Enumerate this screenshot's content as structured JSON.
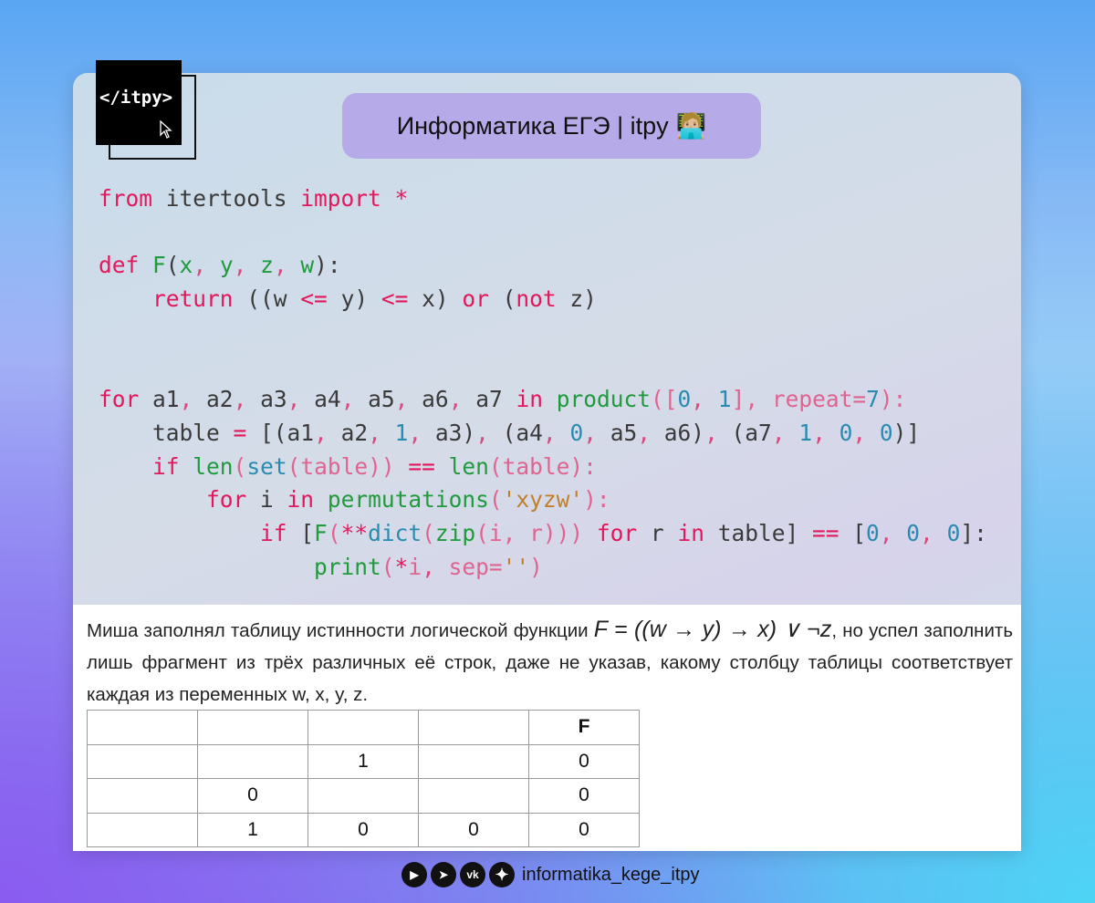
{
  "logo": {
    "text": "</itpy>"
  },
  "header": {
    "title": "Информатика ЕГЭ | itpy",
    "emoji": "🧑🏼‍💻"
  },
  "code": [
    [
      [
        "k",
        "from"
      ],
      [
        "d",
        " itertools "
      ],
      [
        "k",
        "import"
      ],
      [
        "k",
        " *"
      ]
    ],
    [],
    [
      [
        "k",
        "def"
      ],
      [
        "g",
        " F"
      ],
      [
        "d",
        "("
      ],
      [
        "g",
        "x"
      ],
      [
        "c",
        ","
      ],
      [
        "g",
        " y"
      ],
      [
        "c",
        ","
      ],
      [
        "g",
        " z"
      ],
      [
        "c",
        ","
      ],
      [
        "g",
        " w"
      ],
      [
        "d",
        "):"
      ]
    ],
    [
      [
        "d",
        "    "
      ],
      [
        "k",
        "return"
      ],
      [
        "d",
        " ((w "
      ],
      [
        "k",
        "<="
      ],
      [
        "d",
        " y) "
      ],
      [
        "k",
        "<="
      ],
      [
        "d",
        " x) "
      ],
      [
        "k",
        "or"
      ],
      [
        "d",
        " ("
      ],
      [
        "k",
        "not"
      ],
      [
        "d",
        " z)"
      ]
    ],
    [],
    [],
    [
      [
        "k",
        "for"
      ],
      [
        "d",
        " a1"
      ],
      [
        "c",
        ","
      ],
      [
        "d",
        " a2"
      ],
      [
        "c",
        ","
      ],
      [
        "d",
        " a3"
      ],
      [
        "c",
        ","
      ],
      [
        "d",
        " a4"
      ],
      [
        "c",
        ","
      ],
      [
        "d",
        " a5"
      ],
      [
        "c",
        ","
      ],
      [
        "d",
        " a6"
      ],
      [
        "c",
        ","
      ],
      [
        "d",
        " a7 "
      ],
      [
        "k",
        "in"
      ],
      [
        "g",
        " product"
      ],
      [
        "p",
        "(["
      ],
      [
        "n",
        "0"
      ],
      [
        "c",
        ","
      ],
      [
        "n",
        " 1"
      ],
      [
        "p",
        "], repeat="
      ],
      [
        "n",
        "7"
      ],
      [
        "p",
        "):"
      ]
    ],
    [
      [
        "d",
        "    table "
      ],
      [
        "k",
        "="
      ],
      [
        "d",
        " [(a1"
      ],
      [
        "c",
        ","
      ],
      [
        "d",
        " a2"
      ],
      [
        "c",
        ","
      ],
      [
        "n",
        " 1"
      ],
      [
        "c",
        ","
      ],
      [
        "d",
        " a3)"
      ],
      [
        "c",
        ","
      ],
      [
        "d",
        " (a4"
      ],
      [
        "c",
        ","
      ],
      [
        "n",
        " 0"
      ],
      [
        "c",
        ","
      ],
      [
        "d",
        " a5"
      ],
      [
        "c",
        ","
      ],
      [
        "d",
        " a6)"
      ],
      [
        "c",
        ","
      ],
      [
        "d",
        " (a7"
      ],
      [
        "c",
        ","
      ],
      [
        "n",
        " 1"
      ],
      [
        "c",
        ","
      ],
      [
        "n",
        " 0"
      ],
      [
        "c",
        ","
      ],
      [
        "n",
        " 0"
      ],
      [
        "d",
        ")]"
      ]
    ],
    [
      [
        "d",
        "    "
      ],
      [
        "k",
        "if"
      ],
      [
        "g",
        " len"
      ],
      [
        "p",
        "("
      ],
      [
        "n",
        "set"
      ],
      [
        "p",
        "(table))"
      ],
      [
        "k",
        " =="
      ],
      [
        "g",
        " len"
      ],
      [
        "p",
        "(table):"
      ]
    ],
    [
      [
        "d",
        "        "
      ],
      [
        "k",
        "for"
      ],
      [
        "d",
        " i "
      ],
      [
        "k",
        "in"
      ],
      [
        "g",
        " permutations"
      ],
      [
        "p",
        "("
      ],
      [
        "s",
        "'xyzw'"
      ],
      [
        "p",
        "):"
      ]
    ],
    [
      [
        "d",
        "            "
      ],
      [
        "k",
        "if"
      ],
      [
        "d",
        " ["
      ],
      [
        "g",
        "F"
      ],
      [
        "p",
        "("
      ],
      [
        "k",
        "**"
      ],
      [
        "n",
        "dict"
      ],
      [
        "p",
        "("
      ],
      [
        "g",
        "zip"
      ],
      [
        "p",
        "(i, r))) "
      ],
      [
        "k",
        "for"
      ],
      [
        "d",
        " r "
      ],
      [
        "k",
        "in"
      ],
      [
        "d",
        " table] "
      ],
      [
        "k",
        "=="
      ],
      [
        "d",
        " ["
      ],
      [
        "n",
        "0"
      ],
      [
        "c",
        ","
      ],
      [
        "n",
        " 0"
      ],
      [
        "c",
        ","
      ],
      [
        "n",
        " 0"
      ],
      [
        "d",
        "]:"
      ]
    ],
    [
      [
        "d",
        "                "
      ],
      [
        "g",
        "print"
      ],
      [
        "p",
        "("
      ],
      [
        "k",
        "*"
      ],
      [
        "p",
        "i"
      ],
      [
        "c",
        ","
      ],
      [
        "p",
        " sep="
      ],
      [
        "s",
        "''"
      ],
      [
        "p",
        ")"
      ]
    ]
  ],
  "task": {
    "before": "Миша заполнял таблицу истинности логической функции ",
    "formula": "F = ((w → y) → x) ∨ ¬z",
    "after": ", но успел заполнить лишь фрагмент из трёх различных её строк, даже не указав, какому столбцу таблицы соответствует каждая из переменных w, x, y, z."
  },
  "table": [
    [
      "",
      "",
      "",
      "",
      "F"
    ],
    [
      "",
      "",
      "1",
      "",
      "0"
    ],
    [
      "",
      "0",
      "",
      "",
      "0"
    ],
    [
      "",
      "1",
      "0",
      "0",
      "0"
    ]
  ],
  "footer": {
    "handle": "informatika_kege_itpy",
    "icons": [
      "youtube-icon",
      "telegram-icon",
      "vk-icon",
      "star-icon"
    ]
  }
}
